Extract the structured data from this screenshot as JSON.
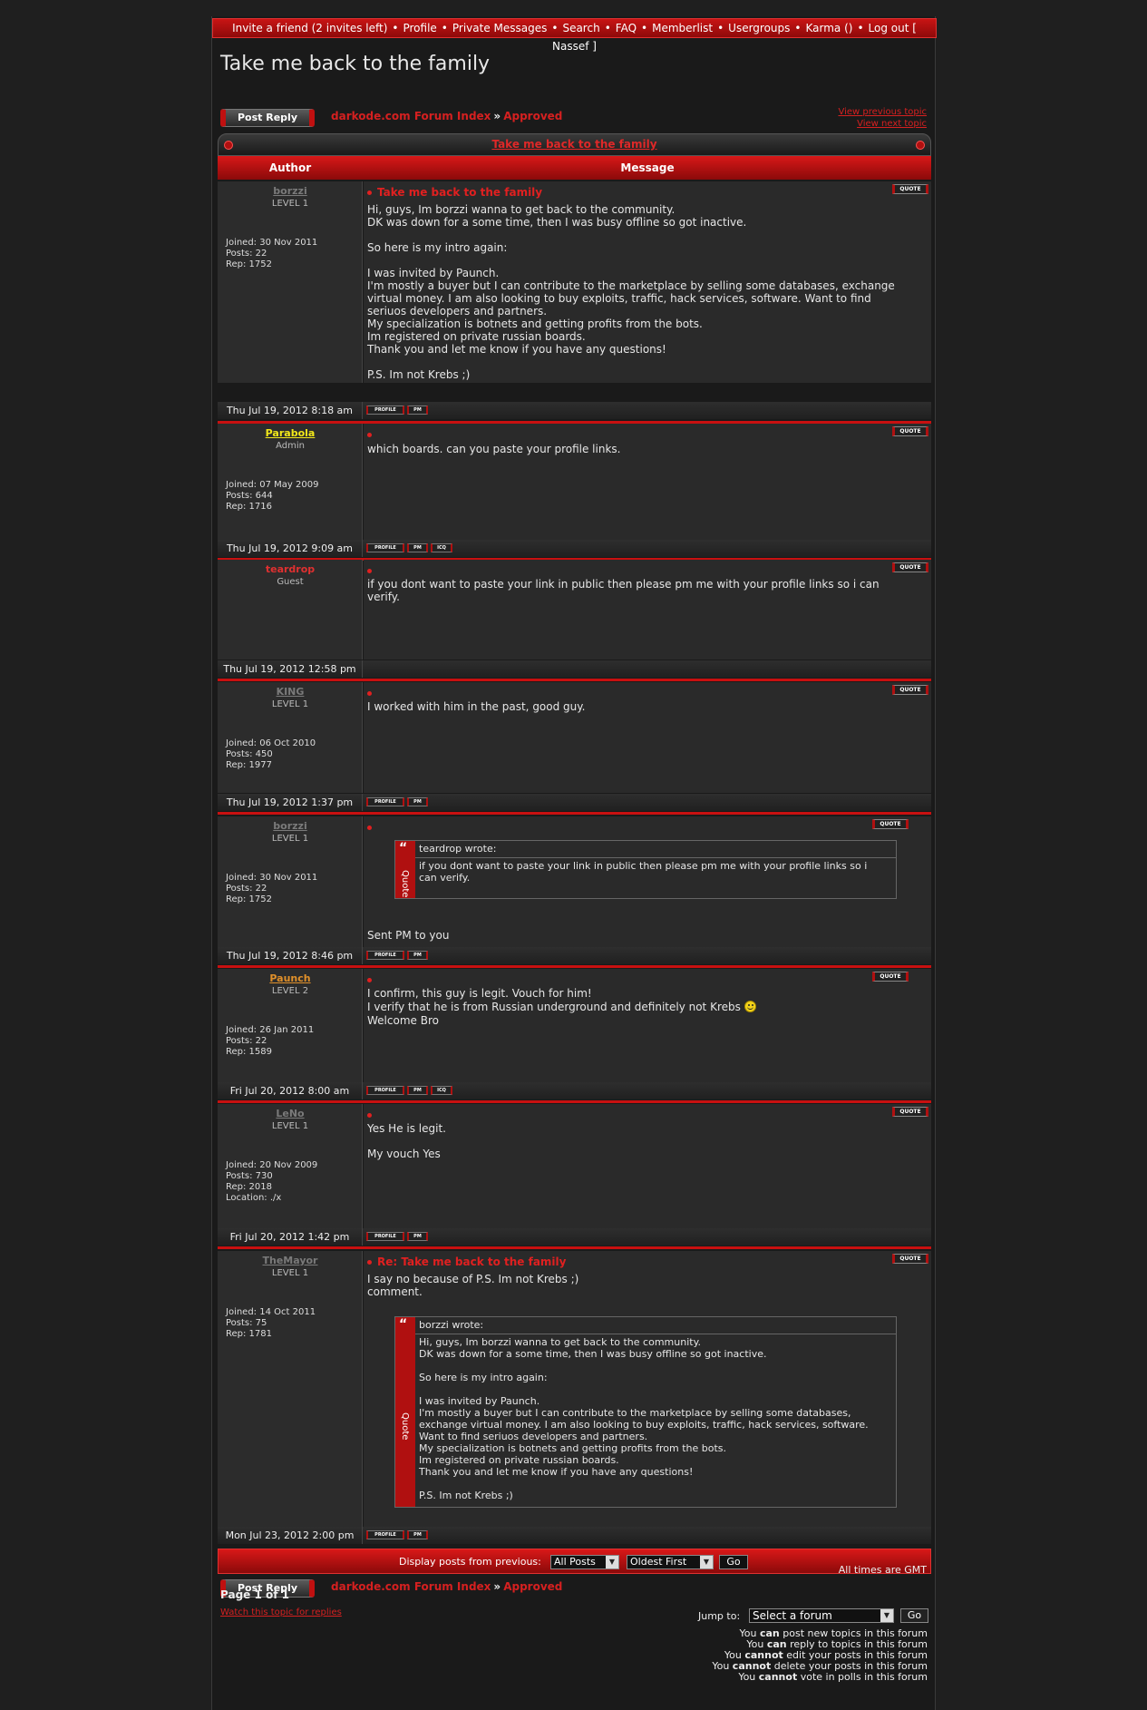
{
  "topnav": {
    "items": [
      "Invite a friend (2 invites left)",
      "Profile",
      "Private Messages",
      "Search",
      "FAQ",
      "Memberlist",
      "Usergroups",
      "Karma ()",
      "Log out [ Nassef ]"
    ],
    "separator": "•"
  },
  "page_title": "Take me back to the family",
  "post_reply_label": "Post Reply",
  "breadcrumb": {
    "index": "darkode.com Forum Index",
    "arrow": "»",
    "forum": "Approved"
  },
  "nav": {
    "prev": "View previous topic",
    "next": "View next topic"
  },
  "topic_title": "Take me back to the family",
  "headers": {
    "author": "Author",
    "message": "Message"
  },
  "buttons": {
    "quote": "QUOTE",
    "profile": "PROFILE",
    "pm": "PM",
    "icq": "ICQ"
  },
  "posts": [
    {
      "author": "borzzi",
      "author_color": "#7a7a7a",
      "rank": "LEVEL 1",
      "joined": "Joined: 30 Nov 2011",
      "posts": "Posts: 22",
      "rep": "Rep: 1752",
      "location": "",
      "subject": "Take me back to the family",
      "body": "Hi, guys, Im borzzi wanna to get back to the community.\nDK was down for a some time, then I was busy offline so got inactive.\n\nSo here is my intro again:\n\nI was invited by Paunch.\nI'm mostly a buyer but I can contribute to the marketplace by selling some databases, exchange\nvirtual money. I am also looking to buy exploits, traffic, hack services, software. Want to find\nseriuos developers and partners.\nMy specialization is botnets and getting profits from the bots.\nIm registered on private russian boards.\nThank you and let me know if you have any questions!\n\nP.S. Im not Krebs ;)",
      "date": "Thu Jul 19, 2012 8:18 am",
      "footer_buttons": [
        "PROFILE",
        "PM"
      ]
    },
    {
      "author": "Parabola",
      "author_color": "#f2e81a",
      "rank": "Admin",
      "joined": "Joined: 07 May 2009",
      "posts": "Posts: 644",
      "rep": "Rep: 1716",
      "location": "",
      "subject": "",
      "body": "which boards. can you paste your profile links.",
      "date": "Thu Jul 19, 2012 9:09 am",
      "footer_buttons": [
        "PROFILE",
        "PM",
        "ICQ"
      ]
    },
    {
      "author": "teardrop",
      "author_color": "#e03030",
      "rank": "Guest",
      "joined": "",
      "posts": "",
      "rep": "",
      "location": "",
      "subject": "",
      "body": "if you dont want to paste your link in public then please pm me with your profile links so i can\nverify.",
      "date": "Thu Jul 19, 2012 12:58 pm",
      "footer_buttons": []
    },
    {
      "author": "KING",
      "author_color": "#7a7a7a",
      "rank": "LEVEL 1",
      "joined": "Joined: 06 Oct 2010",
      "posts": "Posts: 450",
      "rep": "Rep: 1977",
      "location": "",
      "subject": "",
      "body": "I worked with him in the past, good guy.",
      "date": "Thu Jul 19, 2012 1:37 pm",
      "footer_buttons": [
        "PROFILE",
        "PM"
      ]
    },
    {
      "author": "borzzi",
      "author_color": "#7a7a7a",
      "rank": "LEVEL 1",
      "joined": "Joined: 30 Nov 2011",
      "posts": "Posts: 22",
      "rep": "Rep: 1752",
      "location": "",
      "subject": "",
      "quote_author": "teardrop wrote:",
      "quote_body": "if you dont want to paste your link in public then please pm me with your profile links so i\ncan verify.",
      "body": "Sent PM to you",
      "date": "Thu Jul 19, 2012 8:46 pm",
      "footer_buttons": [
        "PROFILE",
        "PM"
      ]
    },
    {
      "author": "Paunch",
      "author_color": "#e0902a",
      "rank": "LEVEL 2",
      "joined": "Joined: 26 Jan 2011",
      "posts": "Posts: 22",
      "rep": "Rep: 1589",
      "location": "",
      "subject": "",
      "body_line1": "I confirm, this guy is legit. Vouch for him!",
      "body_line2": "I verify that he is from Russian underground and definitely not Krebs",
      "body_line3": "Welcome Bro",
      "date": "Fri Jul 20, 2012 8:00 am",
      "footer_buttons": [
        "PROFILE",
        "PM",
        "ICQ"
      ]
    },
    {
      "author": "LeNo",
      "author_color": "#7a7a7a",
      "rank": "LEVEL 1",
      "joined": "Joined: 20 Nov 2009",
      "posts": "Posts: 730",
      "rep": "Rep: 2018",
      "location": "Location: ./x",
      "subject": "",
      "body": "Yes He is legit.\n\nMy vouch Yes",
      "date": "Fri Jul 20, 2012 1:42 pm",
      "footer_buttons": [
        "PROFILE",
        "PM"
      ]
    },
    {
      "author": "TheMayor",
      "author_color": "#7a7a7a",
      "rank": "LEVEL 1",
      "joined": "Joined: 14 Oct 2011",
      "posts": "Posts: 75",
      "rep": "Rep: 1781",
      "location": "",
      "subject": "Re: Take me back to the family",
      "body": "I say no because of P.S. Im not Krebs ;)\ncomment.",
      "quote_author": "borzzi wrote:",
      "quote_body": "Hi, guys, Im borzzi wanna to get back to the community.\nDK was down for a some time, then I was busy offline so got inactive.\n\nSo here is my intro again:\n\nI was invited by Paunch.\nI'm mostly a buyer but I can contribute to the marketplace by selling some databases,\nexchange virtual money. I am also looking to buy exploits, traffic, hack services, software.\nWant to find seriuos developers and partners.\nMy specialization is botnets and getting profits from the bots.\nIm registered on private russian boards.\nThank you and let me know if you have any questions!\n\nP.S. Im not Krebs ;)",
      "date": "Mon Jul 23, 2012 2:00 pm",
      "footer_buttons": [
        "PROFILE",
        "PM"
      ]
    }
  ],
  "quote_label": "Quote",
  "quote_mark": "“",
  "display": {
    "label": "Display posts from previous:",
    "period": "All Posts",
    "order": "Oldest First",
    "go": "Go"
  },
  "timezone": "All times are GMT",
  "page_of": "Page 1 of 1",
  "watch": "Watch this topic for replies",
  "jump": {
    "label": "Jump to:",
    "value": "Select a forum",
    "go": "Go"
  },
  "permissions": [
    {
      "pre": "You ",
      "word": "can",
      "post": " post new topics in this forum"
    },
    {
      "pre": "You ",
      "word": "can",
      "post": " reply to topics in this forum"
    },
    {
      "pre": "You ",
      "word": "cannot",
      "post": " edit your posts in this forum"
    },
    {
      "pre": "You ",
      "word": "cannot",
      "post": " delete your posts in this forum"
    },
    {
      "pre": "You ",
      "word": "cannot",
      "post": " vote in polls in this forum"
    }
  ]
}
